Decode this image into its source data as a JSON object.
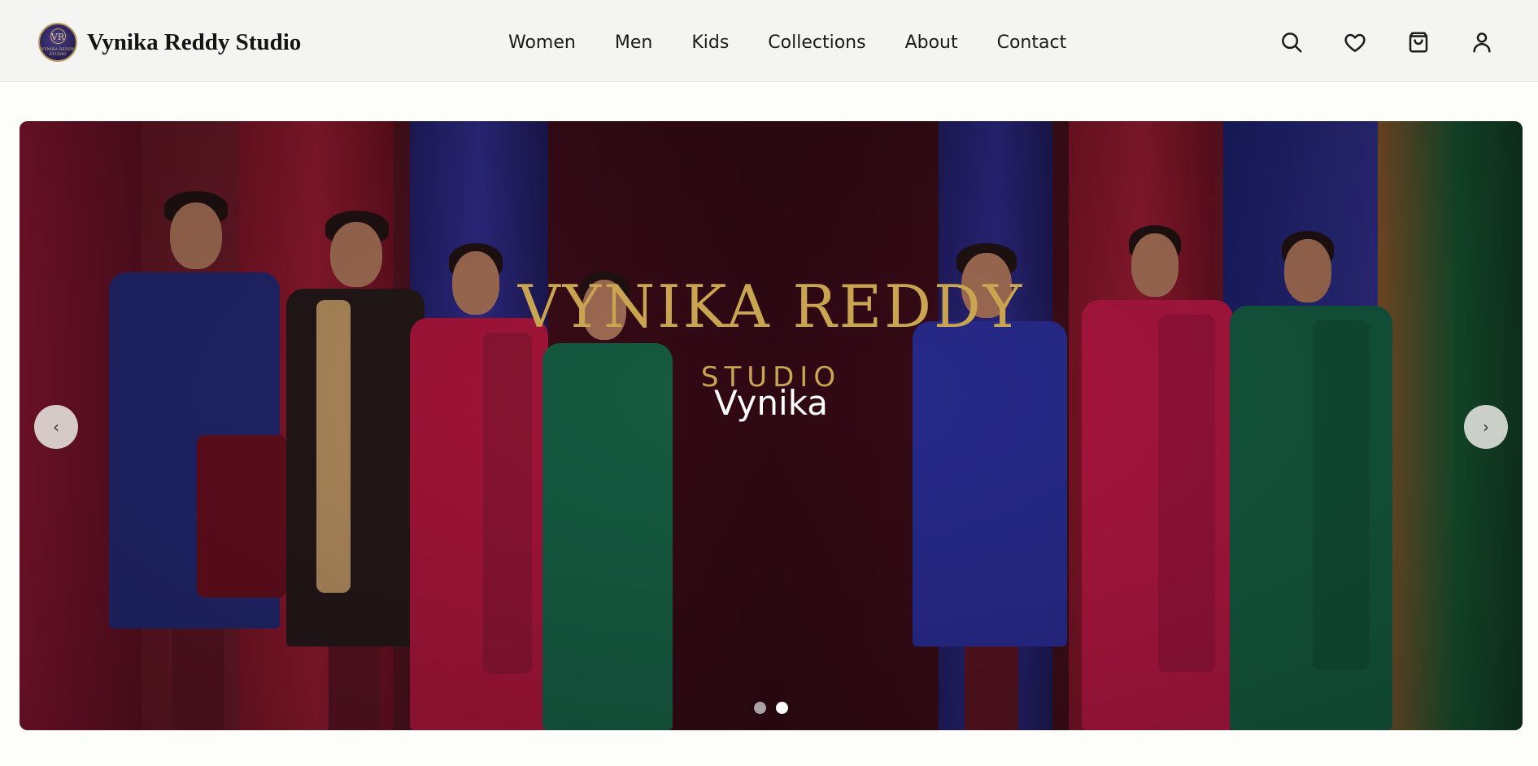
{
  "brand": {
    "name": "Vynika Reddy Studio",
    "logo_monogram": "VR",
    "logo_text": "VYNIKA REDDY STUDIO"
  },
  "nav": {
    "items": [
      "Women",
      "Men",
      "Kids",
      "Collections",
      "About",
      "Contact"
    ]
  },
  "header_icons": [
    "search-icon",
    "heart-icon",
    "bag-icon",
    "user-icon"
  ],
  "hero": {
    "logo_title": "VYNIKA REDDY",
    "logo_subtitle": "STUDIO",
    "caption": "Vynika",
    "prev_label": "‹",
    "next_label": "›",
    "slides": 2,
    "active_slide": 2
  },
  "colors": {
    "brand_gold": "#c9a552",
    "dot_active": "#ffffff",
    "dot_inactive": "#a9a3a5"
  }
}
